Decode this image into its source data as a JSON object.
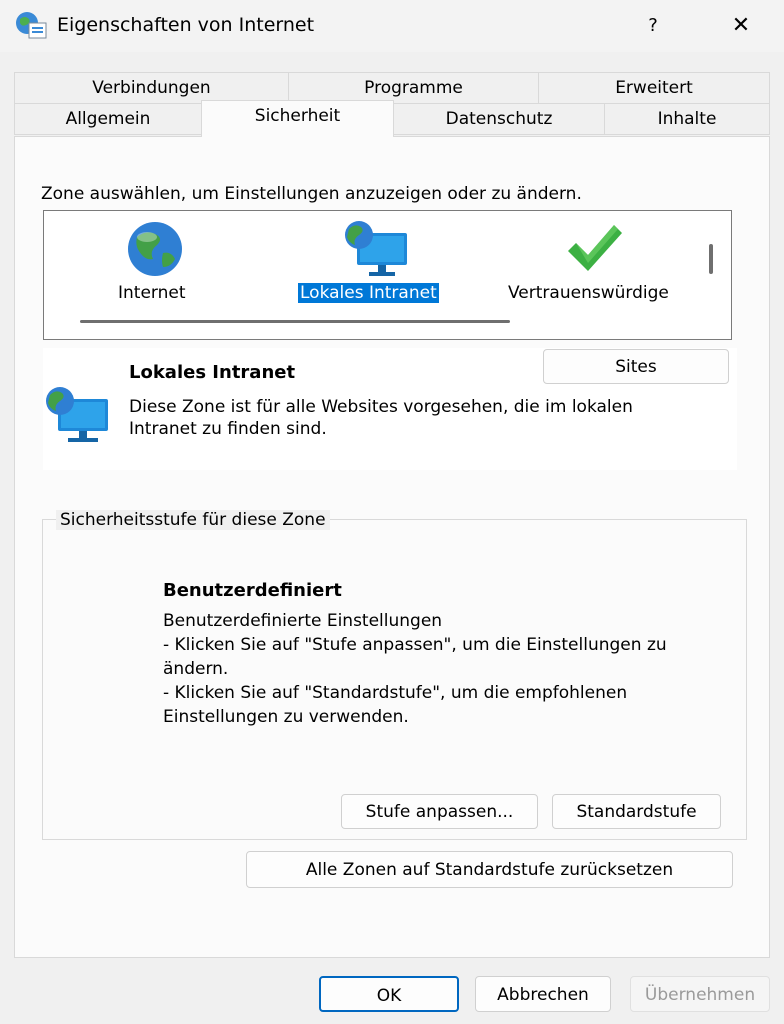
{
  "window": {
    "title": "Eigenschaften von Internet",
    "help_label": "?",
    "close_label": "✕",
    "icon": "internet-options-icon"
  },
  "tabs": {
    "row1": [
      {
        "label": "Verbindungen"
      },
      {
        "label": "Programme"
      },
      {
        "label": "Erweitert"
      }
    ],
    "row2": [
      {
        "label": "Allgemein"
      },
      {
        "label": "Sicherheit"
      },
      {
        "label": "Datenschutz"
      },
      {
        "label": "Inhalte"
      }
    ],
    "active": "Sicherheit"
  },
  "zones": {
    "prompt": "Zone auswählen, um Einstellungen anzuzeigen oder zu ändern.",
    "items": [
      {
        "label": "Internet",
        "icon": "globe-icon"
      },
      {
        "label": "Lokales Intranet",
        "icon": "intranet-monitor-icon"
      },
      {
        "label": "Vertrauenswürdige",
        "icon": "checkmark-icon"
      }
    ],
    "selected": "Lokales Intranet"
  },
  "zone_detail": {
    "name": "Lokales Intranet",
    "description": "Diese Zone ist für alle Websites vorgesehen, die im lokalen Intranet zu finden sind.",
    "sites_button": "Sites"
  },
  "security_level": {
    "legend": "Sicherheitsstufe für diese Zone",
    "level_name": "Benutzerdefiniert",
    "description": "Benutzerdefinierte Einstellungen\n- Klicken Sie auf \"Stufe anpassen\", um die Einstellungen zu ändern.\n- Klicken Sie auf \"Standardstufe\", um die empfohlenen Einstellungen zu verwenden.",
    "custom_button": "Stufe anpassen...",
    "default_button": "Standardstufe"
  },
  "reset_button": "Alle Zonen auf Standardstufe zurücksetzen",
  "footer": {
    "ok": "OK",
    "cancel": "Abbrechen",
    "apply": "Übernehmen"
  },
  "colors": {
    "selection": "#0078d7",
    "ok_border": "#0067c0",
    "check_green": "#3cb043"
  }
}
